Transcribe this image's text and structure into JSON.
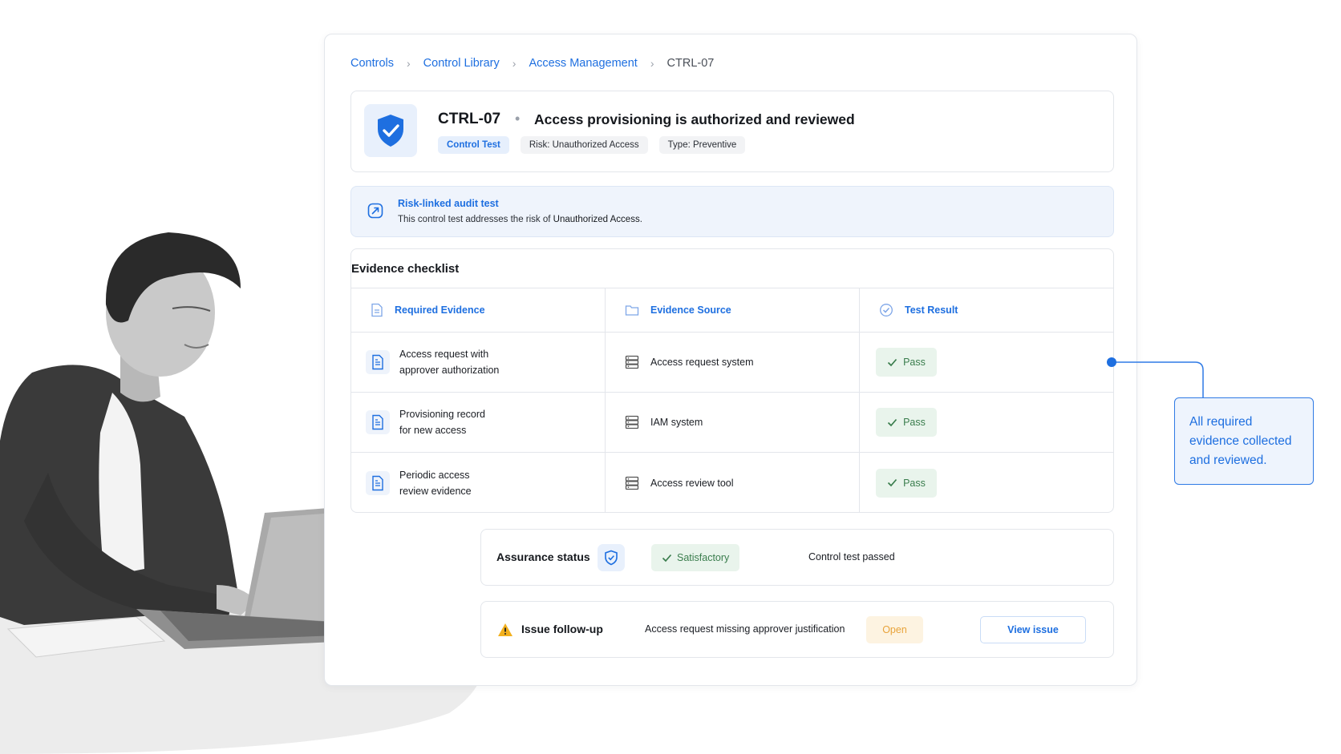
{
  "breadcrumb": {
    "items": [
      "Controls",
      "Control Library",
      "Access Management"
    ],
    "current": "CTRL-07",
    "separator": "›"
  },
  "header": {
    "control_id": "CTRL-07",
    "separator_dot": "•",
    "title": "Access provisioning is authorized and reviewed",
    "chips": [
      "Control Test",
      "Risk: Unauthorized Access",
      "Type: Preventive"
    ],
    "icon": "shield-check-icon"
  },
  "risk_banner": {
    "title": "Risk-linked audit test",
    "text_prefix": "This control test addresses the risk of ",
    "text_risk": "Unauthorized Access",
    "text_suffix": ".",
    "icon": "link-compass-icon"
  },
  "evidence": {
    "title": "Evidence checklist",
    "columns": [
      "Required Evidence",
      "Evidence Source",
      "Test Result"
    ],
    "rows": [
      {
        "line1": "Access request with",
        "line2": "approver authorization",
        "source": "Access request system",
        "result": "Pass"
      },
      {
        "line1": "Provisioning record",
        "line2": "for new access",
        "source": "IAM system",
        "result": "Pass"
      },
      {
        "line1": "Periodic access",
        "line2": "review evidence",
        "source": "Access review tool",
        "result": "Pass"
      }
    ]
  },
  "assurance": {
    "label": "Assurance status",
    "badge": "Satisfactory",
    "note": "Control test passed"
  },
  "issue": {
    "label": "Issue follow-up",
    "text": "Access request missing approver justification",
    "status": "Open",
    "button": "View issue"
  },
  "callout": {
    "line1": "All required",
    "line2": "evidence collected",
    "line3": "and reviewed."
  },
  "colors": {
    "accent": "#1e6fe0",
    "pass_bg": "#e9f4ec",
    "pass_text": "#3a7d4d",
    "open_bg": "#fdf3e1",
    "open_text": "#e8a33a",
    "warning": "#f2b01e"
  }
}
